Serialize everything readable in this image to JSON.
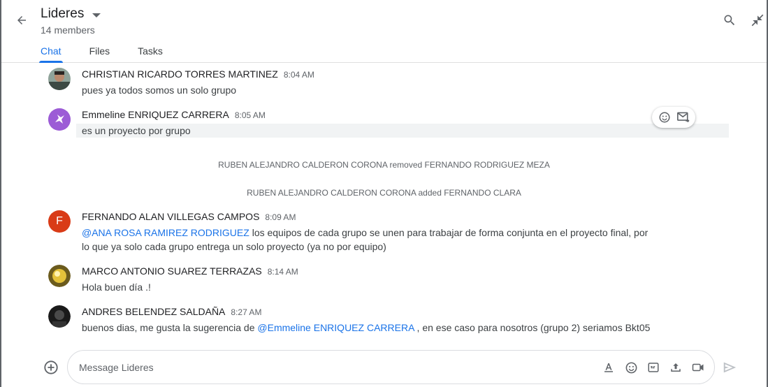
{
  "header": {
    "title": "Lideres",
    "members": "14 members",
    "tabs": [
      {
        "label": "Chat"
      },
      {
        "label": "Files"
      },
      {
        "label": "Tasks"
      }
    ]
  },
  "messages": [
    {
      "sender": "CHRISTIAN RICARDO TORRES MARTINEZ",
      "time": "8:04 AM",
      "text": "pues ya todos somos un solo grupo"
    },
    {
      "sender": "Emmeline ENRIQUEZ CARRERA",
      "time": "8:05 AM",
      "text": "es un proyecto por grupo"
    },
    {
      "sender": "FERNANDO ALAN VILLEGAS CAMPOS",
      "time": "8:09 AM",
      "avatar_letter": "F",
      "mention": "@ANA ROSA RAMIREZ RODRIGUEZ",
      "text_line1": " los equipos de cada grupo se unen para trabajar de forma conjunta en el proyecto final, por",
      "text_line2": "lo que ya solo cada grupo entrega un solo proyecto (ya no por equipo)"
    },
    {
      "sender": "MARCO ANTONIO SUAREZ TERRAZAS",
      "time": "8:14 AM",
      "text": "Hola buen día .!"
    },
    {
      "sender": "ANDRES BELENDEZ SALDAÑA",
      "time": "8:27 AM",
      "text_before": "buenos dias, me gusta la sugerencia de ",
      "mention": "@Emmeline ENRIQUEZ CARRERA",
      "text_after": " , en ese caso para nosotros (grupo 2) seriamos Bkt05"
    }
  ],
  "system_events": [
    "RUBEN ALEJANDRO CALDERON CORONA removed FERNANDO RODRIGUEZ MEZA",
    "RUBEN ALEJANDRO CALDERON CORONA added FERNANDO CLARA"
  ],
  "composer": {
    "placeholder": "Message Lideres"
  },
  "colors": {
    "accent": "#1a73e8",
    "avatar_f": "#d93b17",
    "avatar_emmeline": "#9c5cd6"
  },
  "icons": [
    "arrow-back-icon",
    "dropdown-caret-icon",
    "search-icon",
    "collapse-icon",
    "emoji-icon",
    "forward-mail-icon",
    "add-circle-icon",
    "format-text-icon",
    "gif-icon",
    "upload-icon",
    "video-icon",
    "send-icon"
  ]
}
